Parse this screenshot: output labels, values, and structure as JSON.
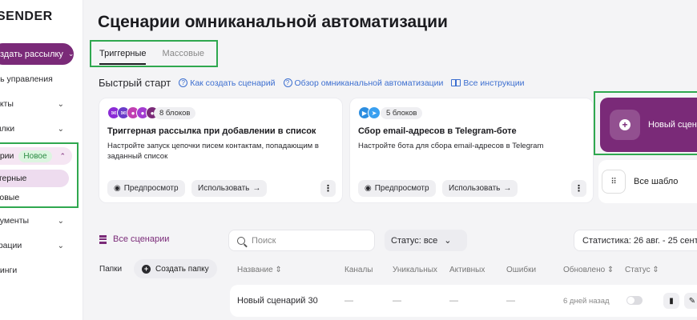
{
  "colors": {
    "brand": "#7a2a78",
    "highlight": "#2fa84f",
    "link": "#3d6fd0"
  },
  "sidebar": {
    "logo": "SENDER",
    "create_button": "здать рассылку",
    "items": [
      {
        "label": "ль управления"
      },
      {
        "label": "акты"
      },
      {
        "label": "ылки"
      },
      {
        "label": "арии",
        "badge": "Новое"
      },
      {
        "label": "гтерные"
      },
      {
        "label": "совые"
      },
      {
        "label": "рументы"
      },
      {
        "label": "грации"
      },
      {
        "label": "ринги"
      }
    ]
  },
  "main": {
    "title": "Сценарии омниканальной автоматизации",
    "tabs": [
      {
        "label": "Триггерные"
      },
      {
        "label": "Массовые"
      }
    ],
    "quick_start": {
      "title": "Быстрый старт",
      "links": [
        {
          "label": "Как создать сценарий",
          "icon": "help-icon"
        },
        {
          "label": "Обзор омниканальной автоматизации",
          "icon": "help-icon"
        },
        {
          "label": "Все инструкции",
          "icon": "book-icon"
        }
      ]
    },
    "cards": [
      {
        "blocks": "8 блоков",
        "title": "Триггерная рассылка при добавлении в список",
        "desc": "Настройте запуск цепочки писем контактам, попадающим в заданный список",
        "preview": "Предпросмотр",
        "use": "Использовать",
        "channel_icons": [
          "#8b2bd6",
          "#6a3cc9",
          "#c13fb2",
          "#a33bd0",
          "#7a2a78"
        ]
      },
      {
        "blocks": "5 блоков",
        "title": "Сбор email-адресов в Telegram-боте",
        "desc": "Настройте бота для сбора email-адресов в Telegram",
        "preview": "Предпросмотр",
        "use": "Использовать",
        "channel_icons": [
          "#2d8ee0",
          "#3aa0f0"
        ]
      }
    ],
    "new_scenario": "Новый сцен",
    "all_templates": "Все шабло",
    "all_scenarios": "Все сценарии",
    "search_placeholder": "Поиск",
    "status_filter": "Статус: все",
    "statistics": "Статистика: 26 авг. - 25 сент",
    "folders_label": "Папки",
    "create_folder": "Создать папку",
    "table": {
      "headers": [
        "Название",
        "Каналы",
        "Уникальных",
        "Активных",
        "Ошибки",
        "Обновлено",
        "Статус"
      ],
      "rows": [
        {
          "name": "Новый сценарий 30",
          "channels": "—",
          "unique": "—",
          "active": "—",
          "errors": "—",
          "updated": "6 дней назад"
        }
      ]
    }
  }
}
